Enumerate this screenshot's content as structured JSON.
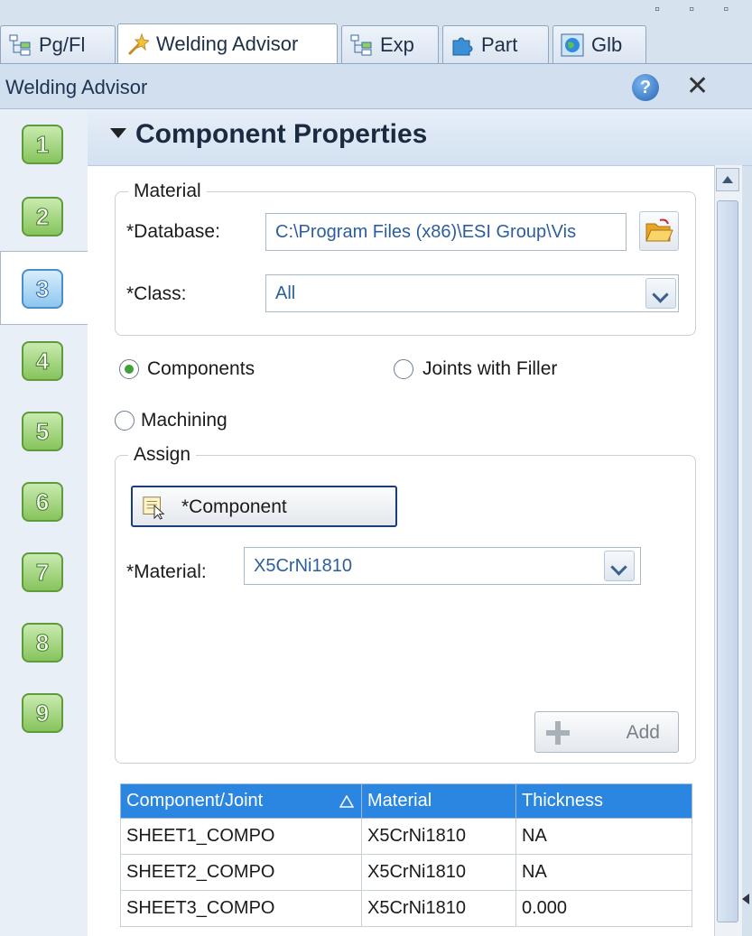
{
  "tabs": [
    {
      "label": "Pg/Fl",
      "icon": "tree-icon"
    },
    {
      "label": "Welding Advisor",
      "icon": "magic-wand-icon"
    },
    {
      "label": "Exp",
      "icon": "tree-icon"
    },
    {
      "label": "Part",
      "icon": "puzzle-piece-icon"
    },
    {
      "label": "Glb",
      "icon": "globe-icon"
    }
  ],
  "panel": {
    "title": "Welding Advisor",
    "help": "?",
    "close": "✕"
  },
  "steps": [
    "1",
    "2",
    "3",
    "4",
    "5",
    "6",
    "7",
    "8",
    "9"
  ],
  "current_step": "3",
  "section": {
    "title": "Component Properties"
  },
  "material_group": {
    "legend": "Material",
    "database_label": "*Database:",
    "database_value": "C:\\Program Files (x86)\\ESI Group\\Vis",
    "class_label": "*Class:",
    "class_value": "All"
  },
  "radios": {
    "components": "Components",
    "joints": "Joints with Filler",
    "machining": "Machining",
    "selected": "components"
  },
  "assign_group": {
    "legend": "Assign",
    "component_button": "*Component",
    "material_label": "*Material:",
    "material_value": "X5CrNi1810",
    "add_button": "Add"
  },
  "table": {
    "headers": [
      "Component/Joint",
      "Material",
      "Thickness"
    ],
    "rows": [
      [
        "SHEET1_COMPO",
        "X5CrNi1810",
        "NA"
      ],
      [
        "SHEET2_COMPO",
        "X5CrNi1810",
        "NA"
      ],
      [
        "SHEET3_COMPO",
        "X5CrNi1810",
        "0.000"
      ]
    ]
  },
  "colors": {
    "header_blue": "#2b86e2",
    "step_green": "#87c45c",
    "step_current": "#8fc6ef"
  }
}
